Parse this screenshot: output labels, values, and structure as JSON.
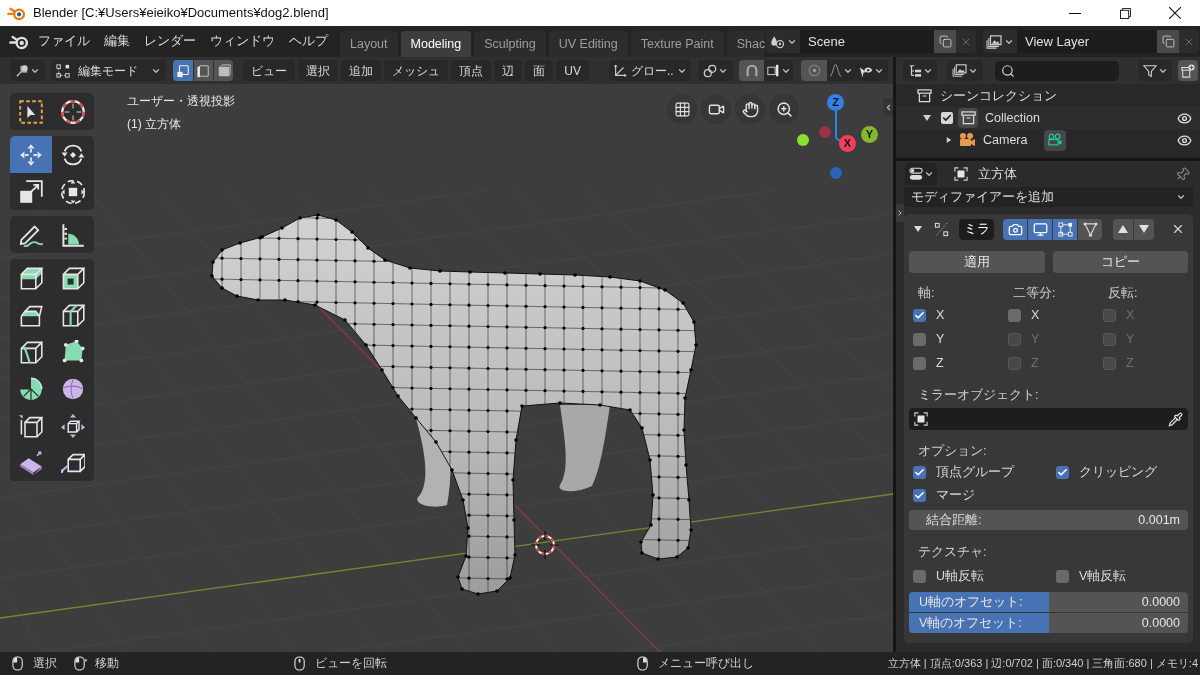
{
  "title_bar": {
    "title": "Blender [C:¥Users¥eieiko¥Documents¥dog2.blend]"
  },
  "top_bar": {
    "menus": [
      "ファイル",
      "編集",
      "レンダー",
      "ウィンドウ",
      "ヘルプ"
    ],
    "workspaces": [
      {
        "label": "Layout",
        "selected": false
      },
      {
        "label": "Modeling",
        "selected": true
      },
      {
        "label": "Sculpting",
        "selected": false
      },
      {
        "label": "UV Editing",
        "selected": false
      },
      {
        "label": "Texture Paint",
        "selected": false
      },
      {
        "label": "Shac",
        "selected": false
      }
    ],
    "scene": "Scene",
    "view_layer": "View Layer"
  },
  "viewport_header": {
    "mode": "編集モード",
    "select_modes": [
      {
        "kind": "vertex",
        "selected": true
      },
      {
        "kind": "edge",
        "selected": false
      },
      {
        "kind": "face",
        "selected": false
      }
    ],
    "menus": [
      "ビュー",
      "選択",
      "追加",
      "メッシュ",
      "頂点",
      "辺",
      "面",
      "UV"
    ],
    "orientation": "グロー.."
  },
  "viewport": {
    "view_name": "ユーザー・透視投影",
    "object_label": "(1) 立方体",
    "tool_groups": [
      [
        {
          "kind": "select_box",
          "selected": false
        },
        {
          "kind": "cursor",
          "selected": false
        }
      ],
      [
        {
          "kind": "move",
          "selected": true
        },
        {
          "kind": "rotate",
          "selected": false
        },
        {
          "kind": "scale",
          "selected": false
        },
        {
          "kind": "transform",
          "selected": false
        }
      ],
      [
        {
          "kind": "annotate",
          "selected": false
        },
        {
          "kind": "measure",
          "selected": false
        }
      ],
      [
        {
          "kind": "extrude",
          "selected": false
        },
        {
          "kind": "inset",
          "selected": false
        },
        {
          "kind": "bevel",
          "selected": false
        },
        {
          "kind": "loop_cut",
          "selected": false
        },
        {
          "kind": "knife",
          "selected": false
        },
        {
          "kind": "poly_build",
          "selected": false
        },
        {
          "kind": "spin",
          "selected": false
        },
        {
          "kind": "smooth",
          "selected": false
        },
        {
          "kind": "edge_slide",
          "selected": false
        },
        {
          "kind": "shrink_fatten",
          "selected": false
        },
        {
          "kind": "shear",
          "selected": false
        },
        {
          "kind": "rip",
          "selected": false
        }
      ]
    ],
    "gizmo_axes": [
      {
        "label": "Z",
        "color": "#2f83e6"
      },
      {
        "label": "Y",
        "color": "#83b92b"
      },
      {
        "label": "X",
        "color": "#f0405c"
      }
    ]
  },
  "outliner": {
    "root": "シーンコレクション",
    "items": [
      {
        "label": "Collection",
        "checked": true,
        "expanded": true,
        "children": [
          {
            "label": "Camera",
            "expanded": false
          }
        ]
      }
    ]
  },
  "properties": {
    "object_name": "立方体",
    "add_modifier": "モディファイアーを追加",
    "modifier": {
      "expanded": true,
      "name": "ミラ",
      "toggles": [
        {
          "kind": "render",
          "on": true
        },
        {
          "kind": "viewport",
          "on": true
        },
        {
          "kind": "editmode",
          "on": true
        },
        {
          "kind": "cage",
          "on": false
        }
      ],
      "apply": "適用",
      "copy": "コピー",
      "axis_groups": [
        {
          "heading": "軸:",
          "items": [
            {
              "label": "X",
              "checked": true,
              "disabled": false
            },
            {
              "label": "Y",
              "checked": false,
              "disabled": false
            },
            {
              "label": "Z",
              "checked": false,
              "disabled": false
            }
          ]
        },
        {
          "heading": "二等分:",
          "items": [
            {
              "label": "X",
              "checked": false,
              "disabled": false
            },
            {
              "label": "Y",
              "checked": false,
              "disabled": true
            },
            {
              "label": "Z",
              "checked": false,
              "disabled": true
            }
          ]
        },
        {
          "heading": "反転:",
          "items": [
            {
              "label": "X",
              "checked": false,
              "disabled": true
            },
            {
              "label": "Y",
              "checked": false,
              "disabled": true
            },
            {
              "label": "Z",
              "checked": false,
              "disabled": true
            }
          ]
        }
      ],
      "mirror_object": {
        "label": "ミラーオブジェクト:"
      },
      "options_heading": "オプション:",
      "options": [
        {
          "label": "頂点グループ",
          "checked": true
        },
        {
          "label": "クリッピング",
          "checked": true
        },
        {
          "label": "マージ",
          "checked": true
        }
      ],
      "merge_distance": {
        "label": "結合距離:",
        "value": "0.001m"
      },
      "texture_heading": "テクスチャ:",
      "texture_flips": [
        {
          "label": "U軸反転",
          "checked": false
        },
        {
          "label": "V軸反転",
          "checked": false
        }
      ],
      "offsets": [
        {
          "label": "U軸のオフセット:",
          "value": "0.0000",
          "level": 0.5
        },
        {
          "label": "V軸のオフセット:",
          "value": "0.0000",
          "level": 0.5
        }
      ]
    }
  },
  "status_bar": {
    "hints": [
      {
        "kind": "left_click",
        "label": "選択"
      },
      {
        "kind": "drag",
        "label": "移動"
      },
      {
        "kind": "middle_click",
        "label": "ビューを回転"
      },
      {
        "kind": "right_click",
        "label": "メニュー呼び出し"
      }
    ],
    "stats": "立方体 | 頂点:0/363 | 辺:0/702 | 面:0/340 | 三角面:680 | メモリ:4"
  }
}
